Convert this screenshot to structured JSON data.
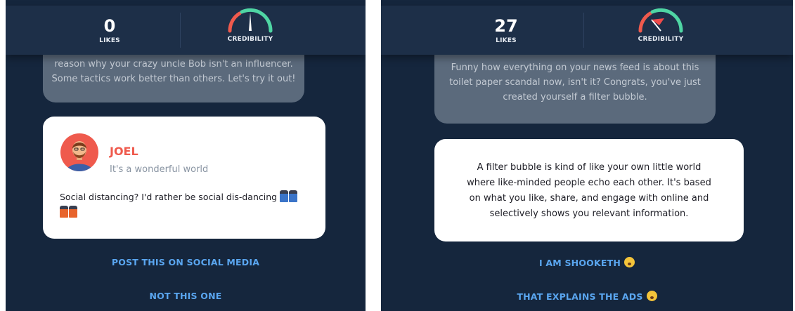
{
  "left_screen": {
    "likes": {
      "count": "0",
      "label": "LIKES"
    },
    "credibility": {
      "label": "CREDIBILITY",
      "icon": "gauge-needle-icon"
    },
    "previous_message": {
      "line1": "reason why your crazy uncle Bob isn't an influencer.",
      "line2": "Some tactics work better than others. Let's try it out!"
    },
    "post": {
      "author": "JOEL",
      "subtitle": "It's a wonderful world",
      "text": "Social distancing? I'd rather be social dis-dancing",
      "emoji_icons": [
        "dancer-blue-icon",
        "dancer-orange-icon"
      ]
    },
    "actions": {
      "primary": "POST THIS ON SOCIAL MEDIA",
      "secondary": "NOT THIS ONE"
    }
  },
  "right_screen": {
    "likes": {
      "count": "27",
      "label": "LIKES"
    },
    "credibility": {
      "label": "CREDIBILITY",
      "icon": "gauge-flag-icon"
    },
    "previous_message": {
      "line1": "Funny how everything on your news feed is about this",
      "line2": "toilet paper scandal now, isn't it? Congrats, you've just",
      "line3": "created yourself a filter bubble."
    },
    "info": {
      "line1": "A filter bubble is kind of like your own little world",
      "line2": "where like-minded people echo each other. It's based",
      "line3": "on what you like, share, and engage with online and",
      "line4": "selectively shows you relevant information."
    },
    "actions": {
      "primary": "I AM SHOOKETH",
      "secondary": "THAT EXPLAINS THE ADS",
      "emoji_icons": [
        "shocked-face-icon",
        "flushed-face-icon"
      ]
    }
  },
  "colors": {
    "background": "#15263d",
    "topbar": "#1d2f48",
    "accent_red": "#ef5a4d",
    "link_blue": "#5aa6f0",
    "gauge_green": "#4fd6a4"
  }
}
